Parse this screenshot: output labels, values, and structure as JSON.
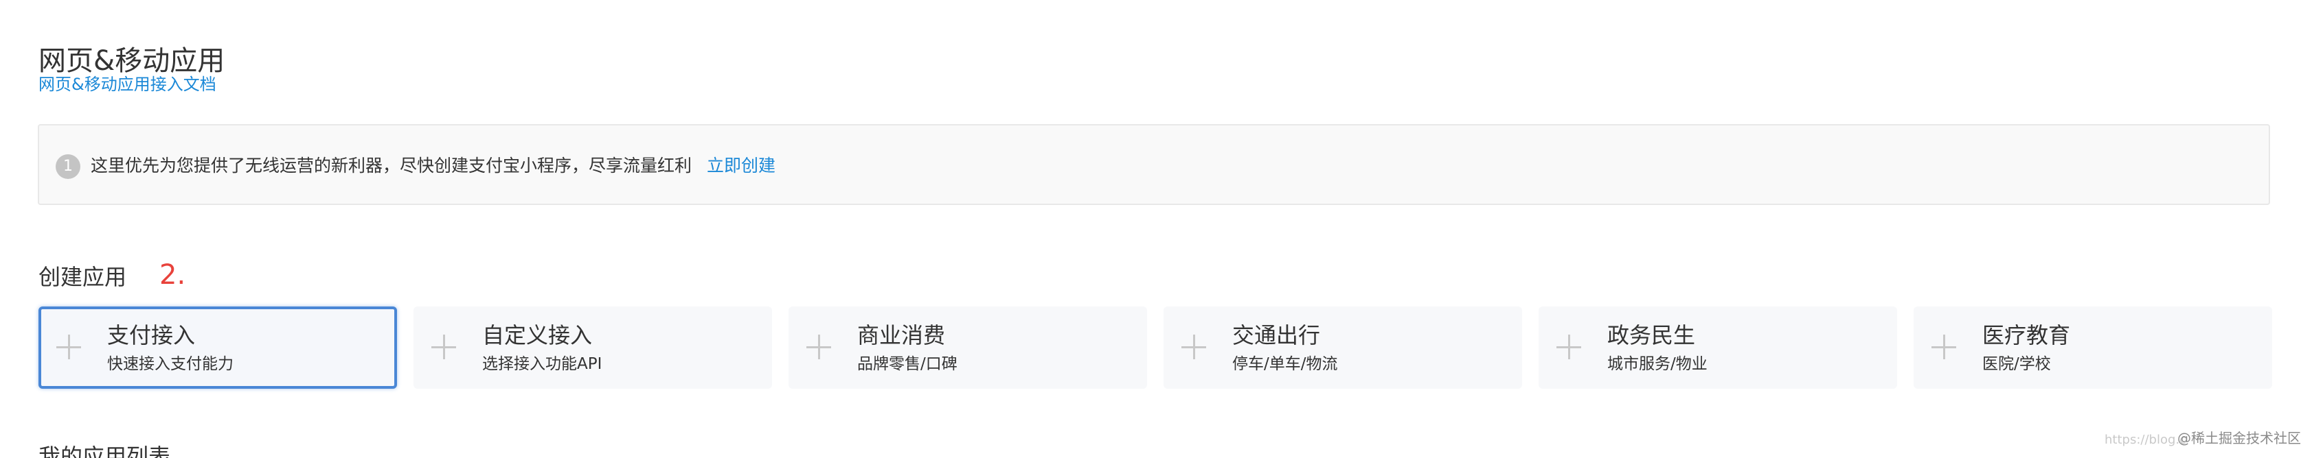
{
  "header": {
    "title": "网页&移动应用",
    "doc_link": "网页&移动应用接入文档"
  },
  "notice": {
    "icon_label": "1",
    "icon": "info-circle-icon",
    "text": "这里优先为您提供了无线运营的新利器，尽快创建支付宝小程序，尽享流量红利",
    "link": "立即创建"
  },
  "create": {
    "title": "创建应用",
    "step_marker": "2.",
    "cards": [
      {
        "title": "支付接入",
        "subtitle": "快速接入支付能力",
        "selected": true
      },
      {
        "title": "自定义接入",
        "subtitle": "选择接入功能API",
        "selected": false
      },
      {
        "title": "商业消费",
        "subtitle": "品牌零售/口碑",
        "selected": false
      },
      {
        "title": "交通出行",
        "subtitle": "停车/单车/物流",
        "selected": false
      },
      {
        "title": "政务民生",
        "subtitle": "城市服务/物业",
        "selected": false
      },
      {
        "title": "医疗教育",
        "subtitle": "医院/学校",
        "selected": false
      }
    ]
  },
  "app_list": {
    "title": "我的应用列表"
  },
  "watermark": {
    "faint": "https://blog.c",
    "text": "@稀土掘金技术社区"
  },
  "colors": {
    "link": "#1b88d7",
    "selected_border": "#4a87d6",
    "step_marker": "#e8423b",
    "card_bg": "#f7f8fa"
  }
}
